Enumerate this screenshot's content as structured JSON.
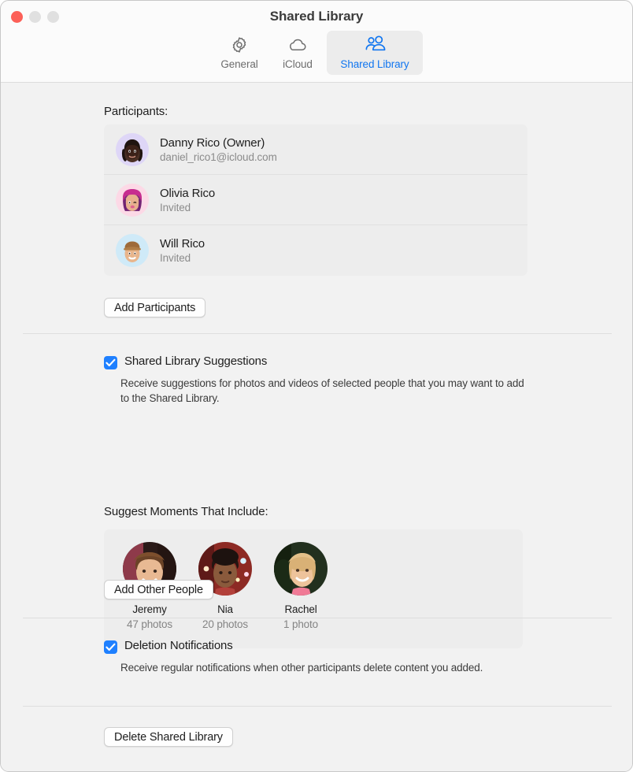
{
  "window": {
    "title": "Shared Library",
    "traffic_lights": [
      "close",
      "minimize",
      "zoom"
    ]
  },
  "toolbar": {
    "tabs": [
      {
        "label": "General",
        "icon": "gear-icon",
        "selected": false
      },
      {
        "label": "iCloud",
        "icon": "cloud-icon",
        "selected": false
      },
      {
        "label": "Shared Library",
        "icon": "people-icon",
        "selected": true
      }
    ]
  },
  "participants_section": {
    "label": "Participants:",
    "rows": [
      {
        "name": "Danny Rico (Owner)",
        "sub": "daniel_rico1@icloud.com",
        "avatar": "memoji-danny"
      },
      {
        "name": "Olivia Rico",
        "sub": "Invited",
        "avatar": "memoji-olivia"
      },
      {
        "name": "Will Rico",
        "sub": "Invited",
        "avatar": "memoji-will"
      }
    ],
    "add_button": "Add Participants"
  },
  "suggestions_section": {
    "checkbox_label": "Shared Library Suggestions",
    "checkbox_checked": true,
    "description": "Receive suggestions for photos and videos of selected people that you may want to add to the Shared Library.",
    "people_label": "Suggest Moments That Include:",
    "people": [
      {
        "name": "Jeremy",
        "count": "47 photos",
        "photo": "photo-jeremy"
      },
      {
        "name": "Nia",
        "count": "20 photos",
        "photo": "photo-nia"
      },
      {
        "name": "Rachel",
        "count": "1 photo",
        "photo": "photo-rachel"
      }
    ],
    "add_button": "Add Other People"
  },
  "deletion_section": {
    "checkbox_label": "Deletion Notifications",
    "checkbox_checked": true,
    "description": "Receive regular notifications when other participants delete content you added."
  },
  "footer": {
    "delete_button": "Delete Shared Library"
  },
  "colors": {
    "accent": "#1f80ff",
    "window_bg": "#f2f2f2",
    "toolbar_bg": "#fbfbfb",
    "panel_bg": "#ededed",
    "close_button": "#fc6058"
  }
}
